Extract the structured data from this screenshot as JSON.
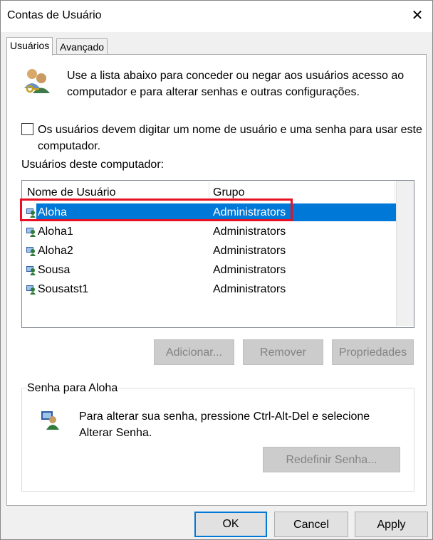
{
  "window": {
    "title": "Contas de Usuário",
    "close_glyph": "✕"
  },
  "tabs": [
    {
      "label": "Usuários"
    },
    {
      "label": "Avançado"
    }
  ],
  "intro_text": "Use a lista abaixo para conceder ou negar aos usuários acesso ao computador e para alterar senhas e outras configurações.",
  "require_login": {
    "label": "Os usuários devem digitar um nome de usuário e uma senha para usar este computador.",
    "checked": false
  },
  "users_list": {
    "label": "Usuários deste computador:",
    "columns": [
      "Nome de Usuário",
      "Grupo"
    ],
    "rows": [
      {
        "name": "Aloha",
        "group": "Administrators",
        "selected": true
      },
      {
        "name": "Aloha1",
        "group": "Administrators",
        "selected": false
      },
      {
        "name": "Aloha2",
        "group": "Administrators",
        "selected": false
      },
      {
        "name": "Sousa",
        "group": "Administrators",
        "selected": false
      },
      {
        "name": "Sousatst1",
        "group": "Administrators",
        "selected": false
      }
    ]
  },
  "list_buttons": {
    "add": "Adicionar...",
    "remove": "Remover",
    "properties": "Propriedades"
  },
  "password_group": {
    "title": "Senha para Aloha",
    "text": "Para alterar sua senha, pressione Ctrl-Alt-Del e selecione Alterar Senha.",
    "reset_button": "Redefinir Senha..."
  },
  "dialog_buttons": {
    "ok": "OK",
    "cancel": "Cancel",
    "apply": "Apply"
  },
  "colors": {
    "selection": "#0078d7",
    "highlight_box": "#e81123"
  }
}
